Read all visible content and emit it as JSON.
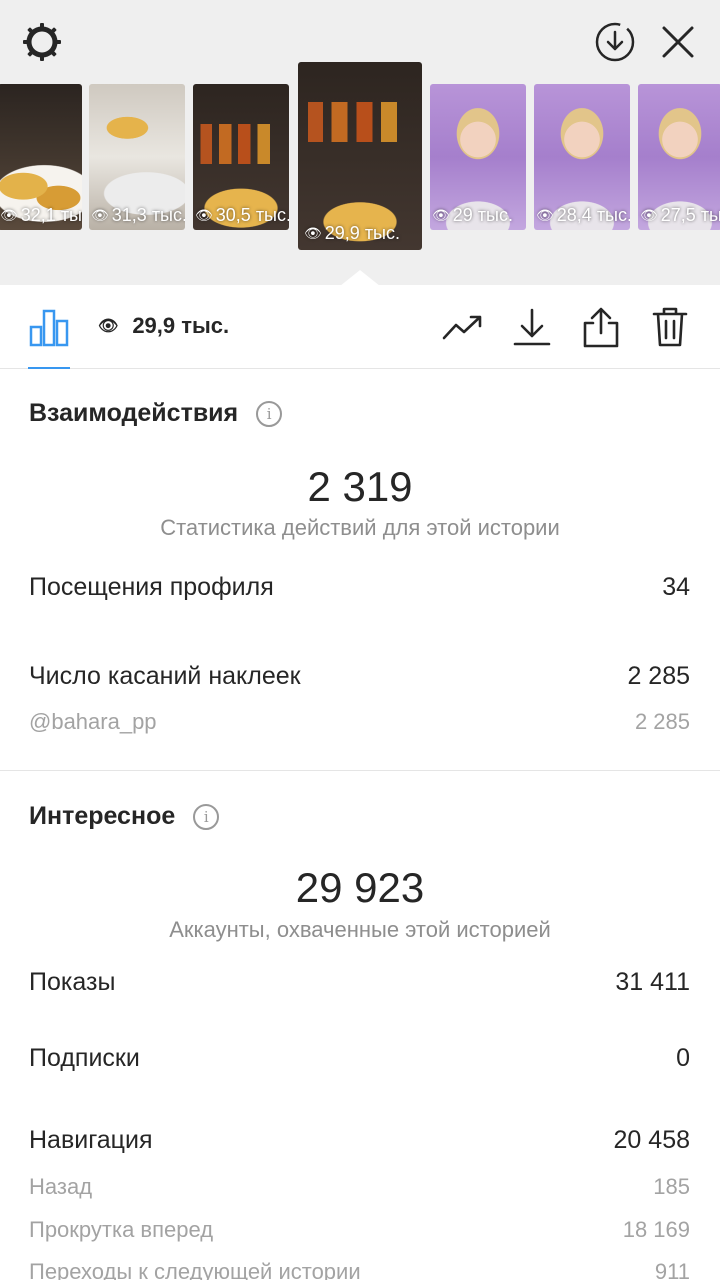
{
  "thumbnails": [
    {
      "views": "32,1 тыс.",
      "style": "food"
    },
    {
      "views": "31,3 тыс.",
      "style": "food2"
    },
    {
      "views": "30,5 тыс.",
      "style": "spice"
    },
    {
      "views": "29,9 тыс.",
      "style": "spice",
      "selected": true
    },
    {
      "views": "29 тыс.",
      "style": "girl"
    },
    {
      "views": "28,4 тыс.",
      "style": "girl"
    },
    {
      "views": "27,5 тыс.",
      "style": "girl"
    }
  ],
  "toolbar": {
    "views": "29,9 тыс."
  },
  "interactions": {
    "title": "Взаимодействия",
    "total": "2 319",
    "caption": "Статистика действий для этой истории",
    "rows": [
      {
        "label": "Посещения профиля",
        "value": "34"
      },
      {
        "label": "Число касаний наклеек",
        "value": "2 285"
      }
    ],
    "sticker_row": {
      "label": "@bahara_pp",
      "value": "2 285"
    }
  },
  "discovery": {
    "title": "Интересное",
    "total": "29 923",
    "caption": "Аккаунты, охваченные этой историей",
    "rows": [
      {
        "label": "Показы",
        "value": "31 411"
      },
      {
        "label": "Подписки",
        "value": "0"
      },
      {
        "label": "Навигация",
        "value": "20 458"
      }
    ],
    "nav_rows": [
      {
        "label": "Назад",
        "value": "185"
      },
      {
        "label": "Прокрутка вперед",
        "value": "18 169"
      },
      {
        "label": "Переходы к следующей истории",
        "value": "911"
      }
    ]
  },
  "colors": {
    "accent": "#3897f0",
    "muted": "#8e8e8e",
    "background_top": "#efefef"
  }
}
